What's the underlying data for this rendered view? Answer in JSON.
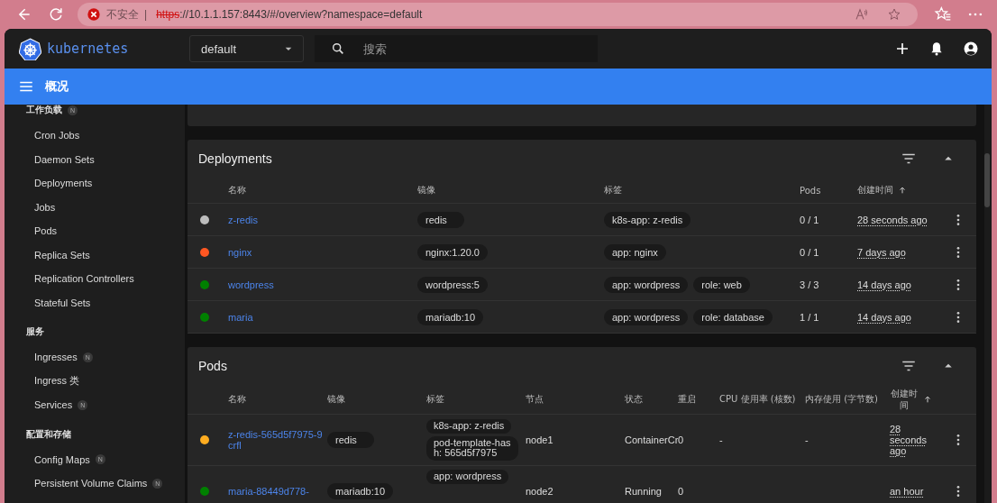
{
  "browser": {
    "security": "不安全",
    "separator": "|",
    "url_scheme": "https",
    "url_rest": "://10.1.1.157:8443/#/overview?namespace=default"
  },
  "header": {
    "logo": "kubernetes",
    "namespace": "default",
    "search": {
      "placeholder": "搜索"
    }
  },
  "toolbar": {
    "title": "概况"
  },
  "sidebar": {
    "sections": [
      {
        "title": "工作负载",
        "badge": "N",
        "items": [
          {
            "label": "Cron Jobs"
          },
          {
            "label": "Daemon Sets"
          },
          {
            "label": "Deployments"
          },
          {
            "label": "Jobs"
          },
          {
            "label": "Pods"
          },
          {
            "label": "Replica Sets"
          },
          {
            "label": "Replication Controllers"
          },
          {
            "label": "Stateful Sets"
          }
        ]
      },
      {
        "title": "服务",
        "items": [
          {
            "label": "Ingresses",
            "badge": "N"
          },
          {
            "label": "Ingress 类"
          },
          {
            "label": "Services",
            "badge": "N"
          }
        ]
      },
      {
        "title": "配置和存储",
        "items": [
          {
            "label": "Config Maps",
            "badge": "N"
          },
          {
            "label": "Persistent Volume Claims",
            "badge": "N"
          }
        ]
      }
    ]
  },
  "deployments": {
    "title": "Deployments",
    "columns": [
      "名称",
      "镜像",
      "标签",
      "Pods",
      "创建时间"
    ],
    "rows": [
      {
        "color": "#bdbdbd",
        "name": "z-redis",
        "image": "redis",
        "labels": [
          "k8s-app: z-redis"
        ],
        "pods": "0 / 1",
        "created": "28 seconds ago"
      },
      {
        "color": "#ff5722",
        "name": "nginx",
        "image": "nginx:1.20.0",
        "labels": [
          "app: nginx"
        ],
        "pods": "0 / 1",
        "created": "7 days ago"
      },
      {
        "color": "#008000",
        "name": "wordpress",
        "image": "wordpress:5",
        "labels": [
          "app: wordpress",
          "role: web"
        ],
        "pods": "3 / 3",
        "created": "14 days ago"
      },
      {
        "color": "#008000",
        "name": "maria",
        "image": "mariadb:10",
        "labels": [
          "app: wordpress",
          "role: database"
        ],
        "pods": "1 / 1",
        "created": "14 days ago"
      }
    ]
  },
  "pods": {
    "title": "Pods",
    "columns": [
      "名称",
      "镜像",
      "标签",
      "节点",
      "状态",
      "重启",
      "CPU 使用率 (核数)",
      "内存使用 (字节数)",
      "创建时间"
    ],
    "rows": [
      {
        "color": "#ffad20",
        "name": "z-redis-565d5f7975-9crfl",
        "image": "redis",
        "labels": [
          "k8s-app: z-redis",
          "pod-template-hash: 565d5f7975"
        ],
        "node": "node1",
        "status": "ContainerCr",
        "restarts": "0",
        "cpu": "-",
        "memory": "-",
        "created": "28 seconds ago"
      },
      {
        "color": "#008000",
        "name": "maria-88449d778-",
        "image": "mariadb:10",
        "labels": [
          "app: wordpress"
        ],
        "node": "node2",
        "status": "Running",
        "restarts": "0",
        "created": "an hour"
      }
    ]
  }
}
